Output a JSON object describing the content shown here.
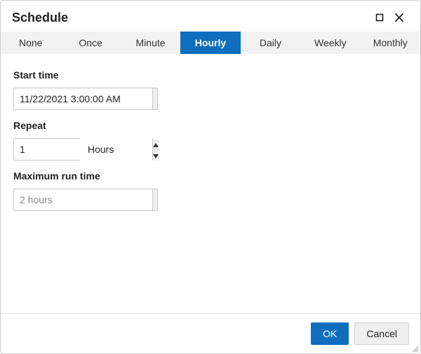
{
  "title": "Schedule",
  "tabs": [
    {
      "label": "None"
    },
    {
      "label": "Once"
    },
    {
      "label": "Minute"
    },
    {
      "label": "Hourly",
      "active": true
    },
    {
      "label": "Daily"
    },
    {
      "label": "Weekly"
    },
    {
      "label": "Monthly"
    }
  ],
  "fields": {
    "start_time": {
      "label": "Start time",
      "value": "11/22/2021 3:00:00 AM"
    },
    "repeat": {
      "label": "Repeat",
      "value": "1",
      "unit": "Hours"
    },
    "max_run": {
      "label": "Maximum run time",
      "placeholder": "2 hours"
    }
  },
  "footer": {
    "ok": "OK",
    "cancel": "Cancel"
  }
}
